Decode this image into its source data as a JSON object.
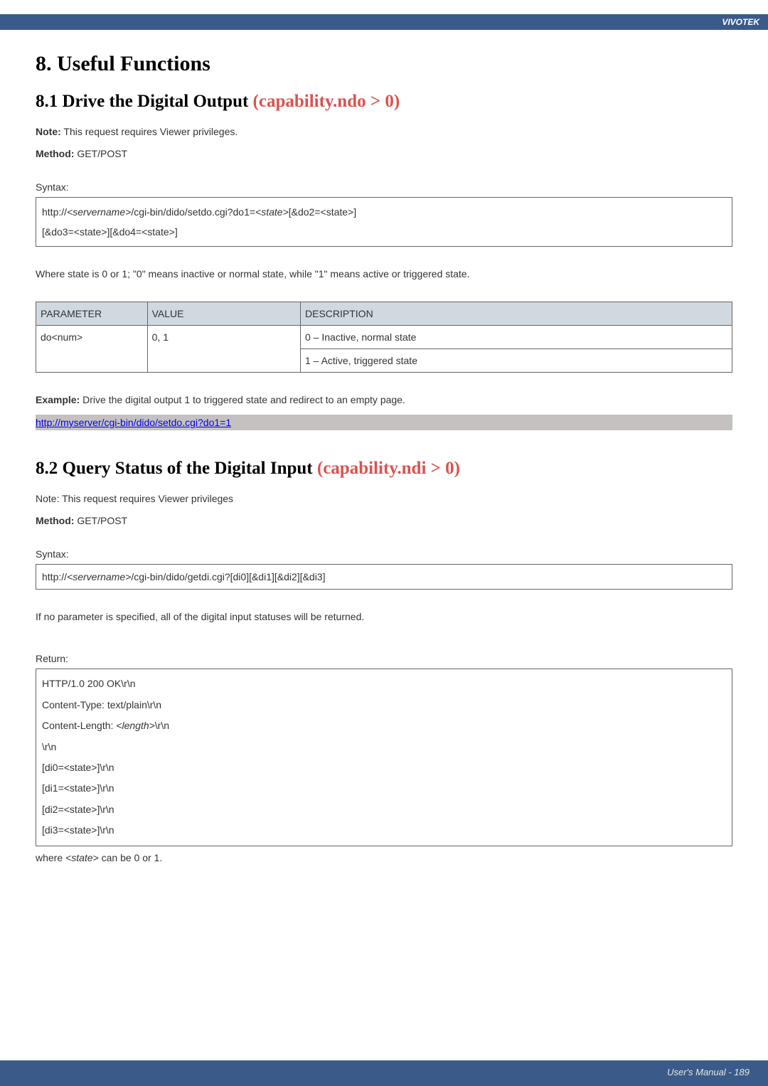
{
  "header": {
    "brand": "VIVOTEK"
  },
  "section8": {
    "title": "8. Useful Functions"
  },
  "section81": {
    "title_prefix": "8.1 Drive the Digital Output ",
    "title_cap": "(capability.ndo > 0)",
    "note_label": "Note:",
    "note_text": " This request requires Viewer privileges.",
    "method_label": "Method:",
    "method_text": " GET/POST",
    "syntax_label": "Syntax:",
    "syntax_l1_a": "http://",
    "syntax_l1_b": "<servername>",
    "syntax_l1_c": "/cgi-bin/dido/setdo.cgi?do1=",
    "syntax_l1_d": "<state>",
    "syntax_l1_e": "[&do2=<state>]",
    "syntax_l2": "[&do3=<state>][&do4=<state>]",
    "where_text": "Where state is 0 or 1; \"0\" means inactive or normal state, while \"1\" means active or triggered state.",
    "table": {
      "col_param": "PARAMETER",
      "col_value": "VALUE",
      "col_desc": "DESCRIPTION",
      "row_param": "do<num>",
      "row_value": "0, 1",
      "row_desc1": "0 – Inactive, normal state",
      "row_desc2": "1 – Active, triggered state"
    },
    "example_label": "Example:",
    "example_text": " Drive the digital output 1 to triggered state and redirect to an empty page.",
    "example_url": "http://myserver/cgi-bin/dido/setdo.cgi?do1=1"
  },
  "section82": {
    "title_prefix": "8.2 Query Status of the Digital Input ",
    "title_cap": "(capability.ndi > 0)",
    "note_text": "Note: This request requires Viewer privileges",
    "method_label": "Method:",
    "method_text": " GET/POST",
    "syntax_label": "Syntax:",
    "syntax_a": "http://",
    "syntax_b": "<servername>",
    "syntax_c": "/cgi-bin/dido/getdi.cgi?[di0][&di1][&di2][&di3]",
    "if_text": "If no parameter is specified, all of the digital input statuses will be returned.",
    "return_label": "Return:",
    "ret_l1": "HTTP/1.0 200 OK\\r\\n",
    "ret_l2": "Content-Type: text/plain\\r\\n",
    "ret_l3_a": "Content-Length: ",
    "ret_l3_b": "<length>",
    "ret_l3_c": "\\r\\n",
    "ret_l4": "\\r\\n",
    "ret_l5": "[di0=<state>]\\r\\n",
    "ret_l6": "[di1=<state>]\\r\\n",
    "ret_l7": "[di2=<state>]\\r\\n",
    "ret_l8": "[di3=<state>]\\r\\n",
    "where_a": "where ",
    "where_b": "<state>",
    "where_c": " can be 0 or 1."
  },
  "footer": {
    "text": "User's Manual - 189"
  }
}
